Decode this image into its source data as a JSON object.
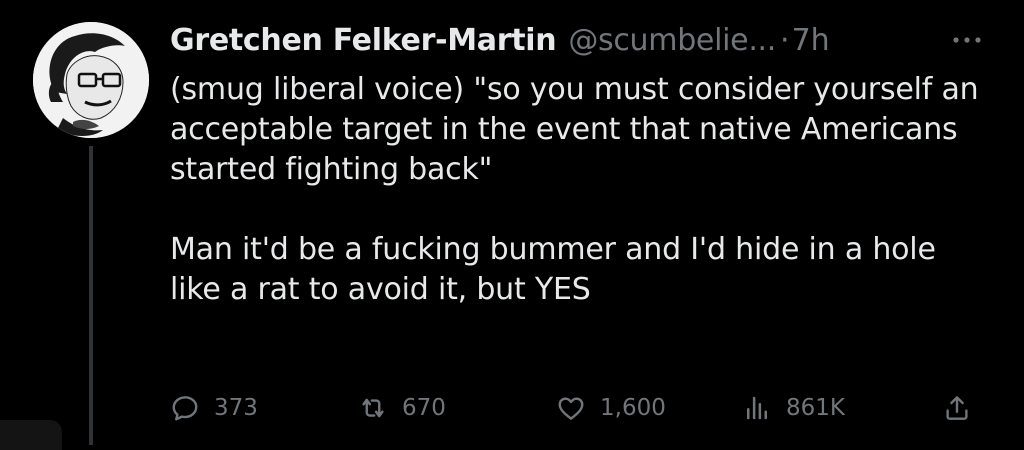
{
  "tweet": {
    "author": {
      "name": "Gretchen Felker-Martin",
      "handle": "@scumbelie...",
      "avatar_icon": "portrait-illustration-icon"
    },
    "separator": "·",
    "time": "7h",
    "more_icon": "ellipsis-icon",
    "paragraphs": [
      "(smug liberal voice) \"so you must consider yourself an acceptable target in the event that native Americans started fighting back\"",
      "Man it'd be a fucking bummer and I'd hide in a hole like a rat to avoid it, but YES"
    ],
    "actions": {
      "reply": {
        "icon": "reply-icon",
        "count": "373"
      },
      "retweet": {
        "icon": "retweet-icon",
        "count": "670"
      },
      "like": {
        "icon": "heart-icon",
        "count": "1,600"
      },
      "views": {
        "icon": "views-chart-icon",
        "count": "861K"
      },
      "share": {
        "icon": "share-icon"
      }
    }
  },
  "colors": {
    "background": "#000000",
    "text": "#e7e9ea",
    "secondary": "#71767b",
    "thread_line": "#2f3336"
  }
}
